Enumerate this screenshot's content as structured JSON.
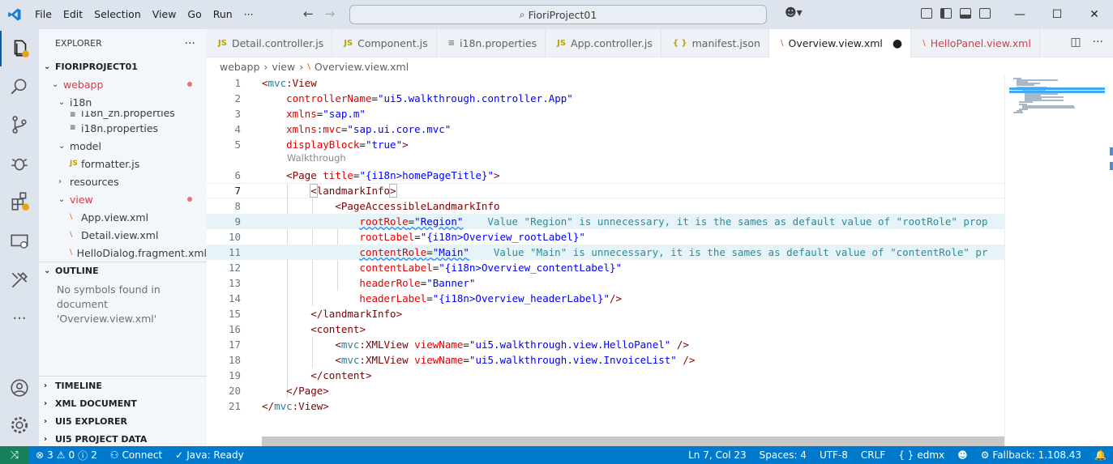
{
  "menu": {
    "file": "File",
    "edit": "Edit",
    "selection": "Selection",
    "view": "View",
    "go": "Go",
    "run": "Run",
    "more": "···"
  },
  "command_center": {
    "text": "FioriProject01"
  },
  "sidebar": {
    "explorer_title": "EXPLORER",
    "explorer_more": "···",
    "project": "FIORIPROJECT01",
    "tree": [
      {
        "label": "webapp",
        "indent": 1,
        "type": "folder",
        "open": true,
        "modified": true
      },
      {
        "label": "i18n",
        "indent": 2,
        "type": "folder",
        "open": true,
        "modified": false
      },
      {
        "label": "i18n_zh.properties",
        "indent": 3,
        "type": "props",
        "modified": false
      },
      {
        "label": "i18n.properties",
        "indent": 3,
        "type": "props",
        "modified": false
      },
      {
        "label": "model",
        "indent": 2,
        "type": "folder",
        "open": true,
        "modified": false
      },
      {
        "label": "formatter.js",
        "indent": 3,
        "type": "js",
        "modified": false
      },
      {
        "label": "resources",
        "indent": 2,
        "type": "folder",
        "open": false,
        "modified": false
      },
      {
        "label": "view",
        "indent": 2,
        "type": "folder",
        "open": true,
        "modified": true
      },
      {
        "label": "App.view.xml",
        "indent": 3,
        "type": "xml",
        "modified": false
      },
      {
        "label": "Detail.view.xml",
        "indent": 3,
        "type": "xml",
        "modified": false
      },
      {
        "label": "HelloDialog.fragment.xml",
        "indent": 3,
        "type": "xml",
        "modified": false
      }
    ],
    "outline_title": "OUTLINE",
    "outline_text": "No symbols found in document 'Overview.view.xml'",
    "bottom_sections": [
      "TIMELINE",
      "XML DOCUMENT",
      "UI5 EXPLORER",
      "UI5 PROJECT DATA"
    ]
  },
  "tabs": [
    {
      "label": "Detail.controller.js",
      "icon": "JS",
      "kind": "js"
    },
    {
      "label": "Component.js",
      "icon": "JS",
      "kind": "js"
    },
    {
      "label": "i18n.properties",
      "icon": "≡",
      "kind": "props"
    },
    {
      "label": "App.controller.js",
      "icon": "JS",
      "kind": "js"
    },
    {
      "label": "manifest.json",
      "icon": "{ }",
      "kind": "json"
    },
    {
      "label": "Overview.view.xml",
      "icon": "\\",
      "kind": "xml",
      "active": true,
      "dirty": true
    },
    {
      "label": "HelloPanel.view.xml",
      "icon": "\\",
      "kind": "xml",
      "error": true
    }
  ],
  "breadcrumb": [
    "webapp",
    "view",
    "Overview.view.xml"
  ],
  "editor": {
    "codelens": "Walkthrough",
    "lines": [
      "<mvc:View",
      "    controllerName=\"ui5.walkthrough.controller.App\"",
      "    xmlns=\"sap.m\"",
      "    xmlns:mvc=\"sap.ui.core.mvc\"",
      "    displayBlock=\"true\">",
      "    <Page title=\"{i18n>homePageTitle}\">",
      "        <landmarkInfo>",
      "            <PageAccessibleLandmarkInfo",
      "                rootRole=\"Region\"",
      "                rootLabel=\"{i18n>Overview_rootLabel}\"",
      "                contentRole=\"Main\"",
      "                contentLabel=\"{i18n>Overview_contentLabel}\"",
      "                headerRole=\"Banner\"",
      "                headerLabel=\"{i18n>Overview_headerLabel}\"/>",
      "        </landmarkInfo>",
      "        <content>",
      "            <mvc:XMLView viewName=\"ui5.walkthrough.view.HelloPanel\" />",
      "            <mvc:XMLView viewName=\"ui5.walkthrough.view.InvoiceList\" />",
      "        </content>",
      "    </Page>",
      "</mvc:View>"
    ],
    "diagnostics": {
      "9": "Value \"Region\" is unnecessary, it is the sames as default value of \"rootRole\" prop",
      "11": "Value \"Main\" is unnecessary, it is the sames as default value of \"contentRole\" pr"
    }
  },
  "statusbar": {
    "errors": "3",
    "warnings": "0",
    "infos": "2",
    "connect": "Connect",
    "java": "Java: Ready",
    "position": "Ln 7, Col 23",
    "spaces": "Spaces: 4",
    "encoding": "UTF-8",
    "eol": "CRLF",
    "language": "edmx",
    "fallback": "Fallback: 1.108.43"
  },
  "colors": {
    "accent": "#007acc",
    "titlebar": "#dde4ee",
    "tag": "#800000",
    "attribute": "#e50000",
    "value": "#0000ff",
    "diagnostic": "#288d9c"
  }
}
